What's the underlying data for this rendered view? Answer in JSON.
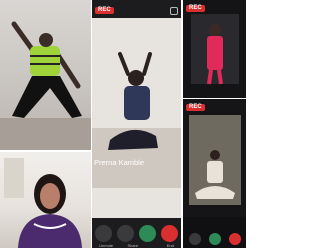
{
  "grid": {
    "tile_top_left": {
      "role": "participant-video"
    },
    "tile_bottom_left": {
      "role": "participant-video"
    },
    "tile_center": {
      "role": "host-video",
      "recording_badge": "REC",
      "participant_name": "Prerna Kamble",
      "control_labels": [
        "Unmute",
        "Share",
        "",
        "End"
      ]
    },
    "tile_top_right": {
      "role": "participant-video",
      "recording_badge": "REC"
    },
    "tile_bottom_right": {
      "role": "participant-video",
      "recording_badge": "REC"
    }
  },
  "colors": {
    "rec_red": "#d9302f",
    "call_green": "#2e8b57",
    "end_red": "#d9302f",
    "dark_background": "#1c1c1e"
  }
}
